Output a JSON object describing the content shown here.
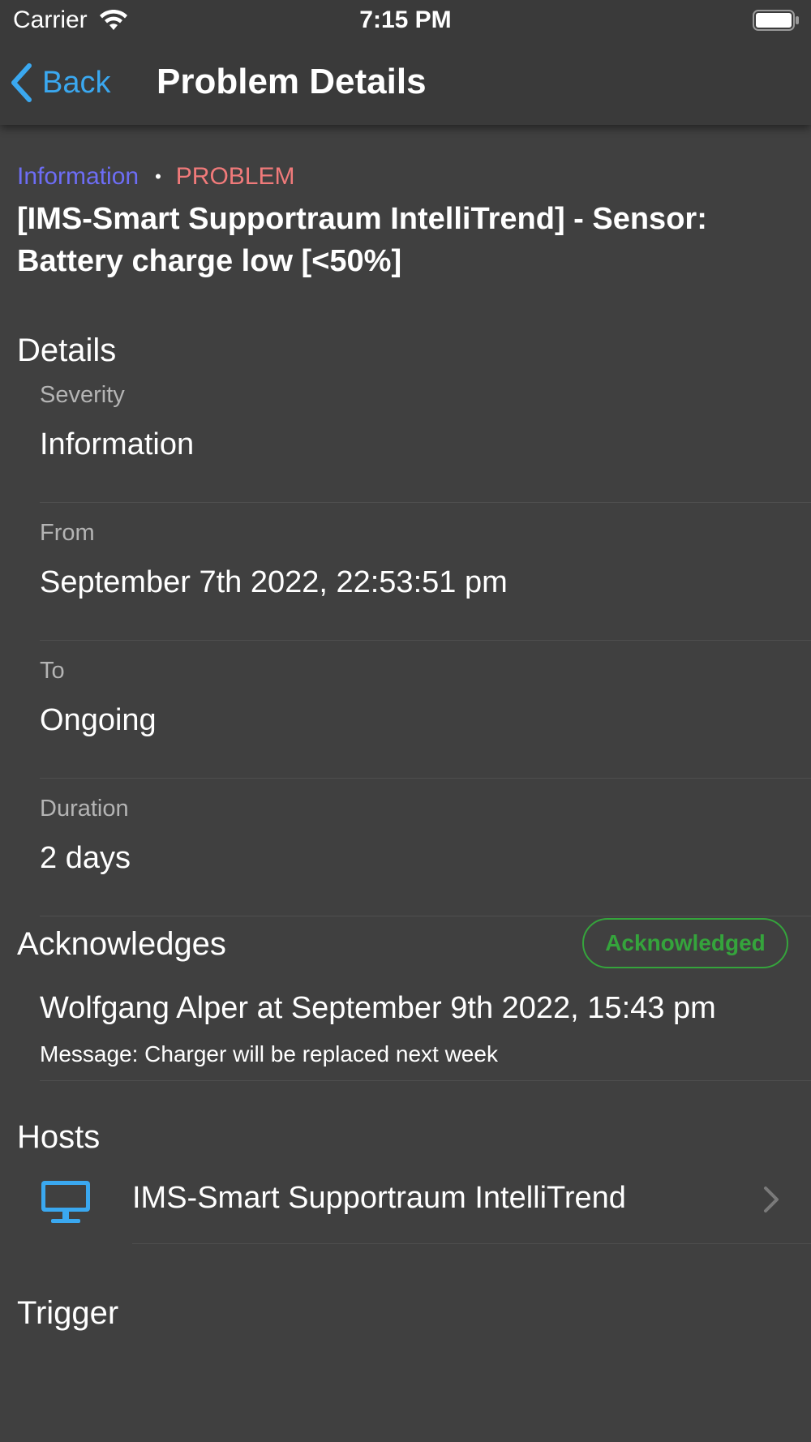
{
  "status_bar": {
    "carrier": "Carrier",
    "time": "7:15 PM",
    "wifi_icon": "wifi-icon",
    "battery_icon": "battery-icon"
  },
  "nav": {
    "back_label": "Back",
    "back_icon": "chevron-left-icon",
    "title": "Problem Details",
    "accent_color": "#3aa8f0"
  },
  "problem": {
    "severity_tag": "Information",
    "separator": "•",
    "status_tag": "PROBLEM",
    "title": "[IMS-Smart Supportraum IntelliTrend] - Sensor: Battery charge low [<50%]",
    "severity_color": "#6d6df5",
    "status_color": "#f07a7a"
  },
  "details": {
    "header": "Details",
    "fields": [
      {
        "label": "Severity",
        "value": "Information"
      },
      {
        "label": "From",
        "value": "September 7th 2022, 22:53:51 pm"
      },
      {
        "label": "To",
        "value": "Ongoing"
      },
      {
        "label": "Duration",
        "value": "2 days"
      }
    ]
  },
  "acknowledges": {
    "header": "Acknowledges",
    "badge": "Acknowledged",
    "badge_color": "#35a43c",
    "items": [
      {
        "user_line": "Wolfgang Alper at September 9th 2022, 15:43 pm",
        "message": "Message: Charger will be replaced next week"
      }
    ]
  },
  "hosts": {
    "header": "Hosts",
    "items": [
      {
        "icon": "desktop-icon",
        "name": "IMS-Smart Supportraum IntelliTrend",
        "chevron": "chevron-right-icon"
      }
    ]
  },
  "trigger": {
    "header": "Trigger"
  }
}
